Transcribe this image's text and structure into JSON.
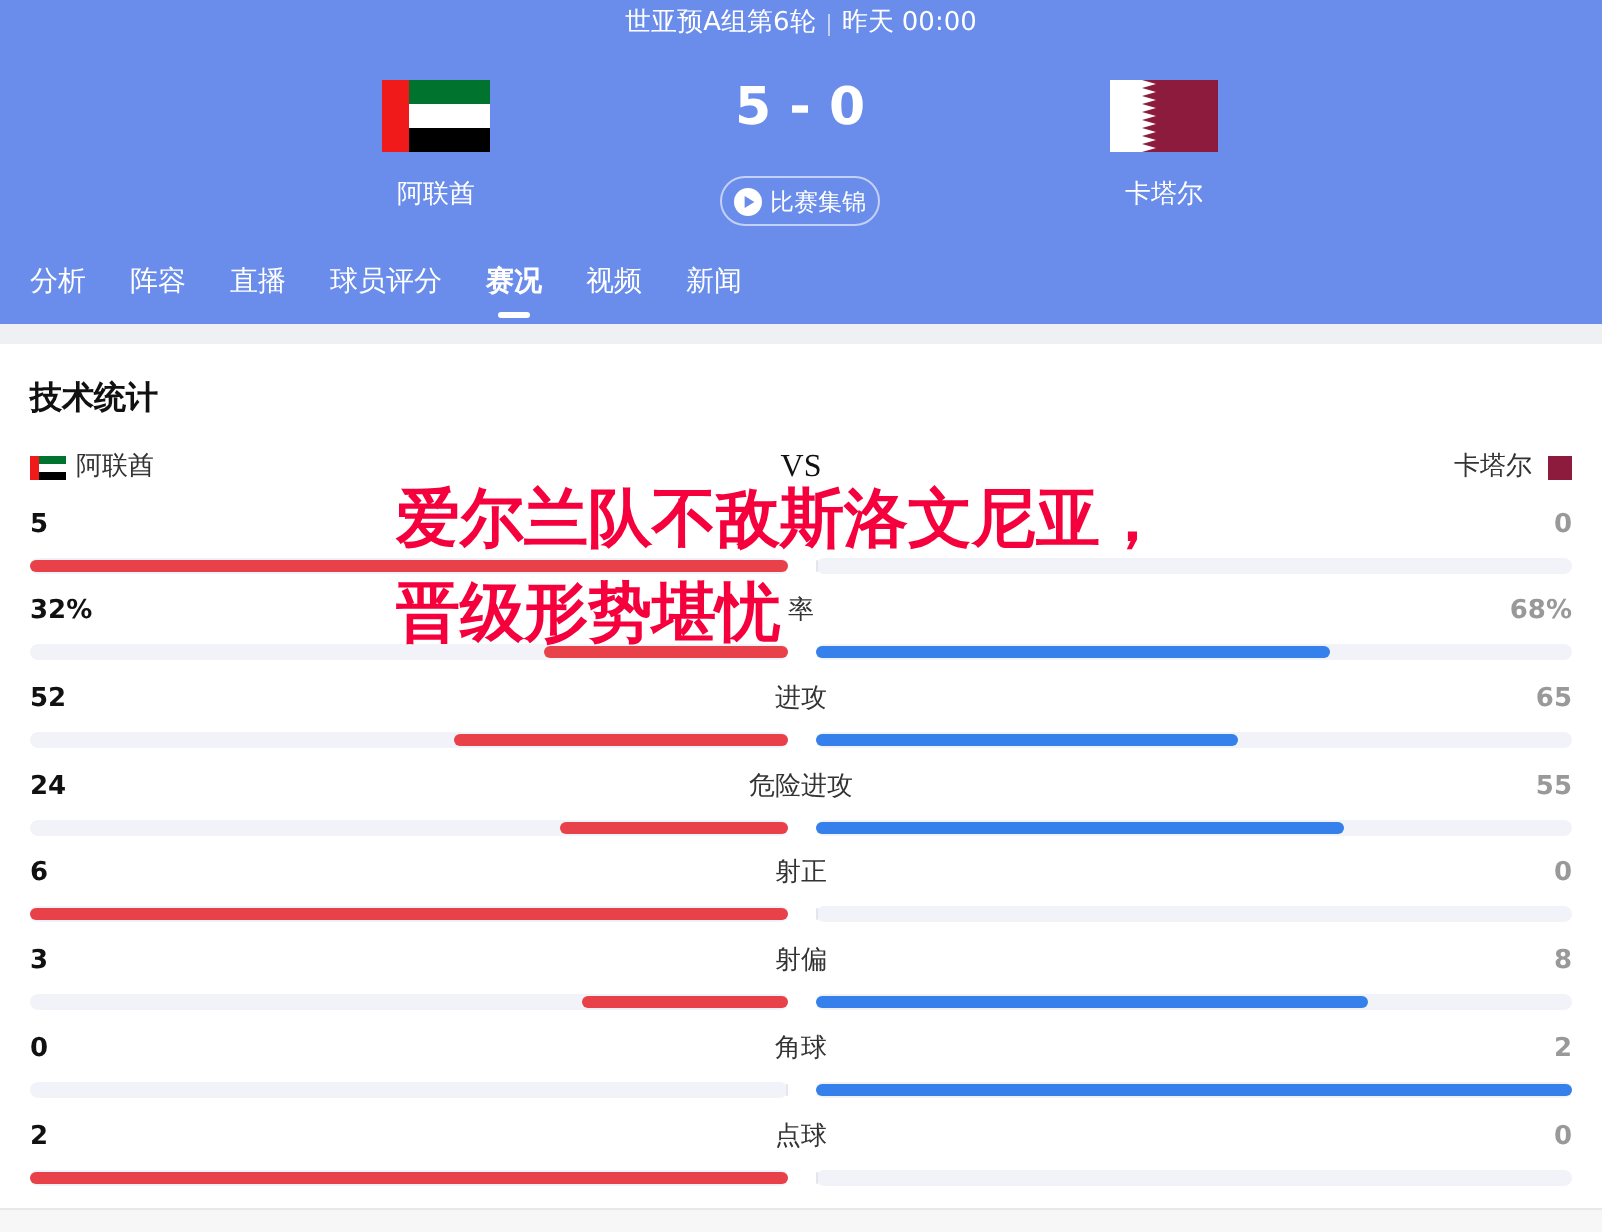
{
  "header": {
    "round": "世亚预A组第6轮",
    "time": "昨天 00:00",
    "home_team": "阿联酋",
    "score": "5 - 0",
    "away_team": "卡塔尔",
    "highlights_button": "比赛集锦"
  },
  "tabs": [
    {
      "label": "分析",
      "selected": false
    },
    {
      "label": "阵容",
      "selected": false
    },
    {
      "label": "直播",
      "selected": false
    },
    {
      "label": "球员评分",
      "selected": false
    },
    {
      "label": "赛况",
      "selected": true
    },
    {
      "label": "视频",
      "selected": false
    },
    {
      "label": "新闻",
      "selected": false
    }
  ],
  "stats": {
    "title": "技术统计",
    "home_team": "阿联酋",
    "vs": "VS",
    "away_team": "卡塔尔",
    "rows": [
      {
        "home": {
          "value": "5",
          "level": 1
        },
        "away": {
          "value": "0",
          "level": 0
        }
      },
      {
        "label": "率",
        "home": {
          "value": "32%",
          "level": 0.32
        },
        "away": {
          "value": "68%",
          "level": 0.68
        }
      },
      {
        "label": "进攻",
        "home": {
          "value": "52",
          "level": 0.44
        },
        "away": {
          "value": "65",
          "level": 0.56
        }
      },
      {
        "label": "危险进攻",
        "home": {
          "value": "24",
          "level": 0.3
        },
        "away": {
          "value": "55",
          "level": 0.7
        }
      },
      {
        "label": "射正",
        "home": {
          "value": "6",
          "level": 1
        },
        "away": {
          "value": "0",
          "level": 0
        }
      },
      {
        "label": "射偏",
        "home": {
          "value": "3",
          "level": 0.27
        },
        "away": {
          "value": "8",
          "level": 0.73
        }
      },
      {
        "label": "角球",
        "home": {
          "value": "0",
          "level": 0
        },
        "away": {
          "value": "2",
          "level": 1
        }
      },
      {
        "label": "点球",
        "home": {
          "value": "2",
          "level": 1
        },
        "away": {
          "value": "0",
          "level": 0
        }
      }
    ]
  },
  "headline": [
    "爱尔兰队不敌斯洛文尼亚，",
    "晋级形势堪忧"
  ]
}
